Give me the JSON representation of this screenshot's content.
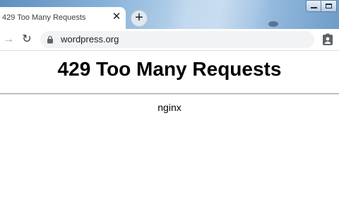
{
  "browser": {
    "tab": {
      "title": "429 Too Many Requests",
      "close_glyph": "✕"
    },
    "new_tab_glyph": "+",
    "toolbar": {
      "back_glyph": "→",
      "reload_glyph": "↻",
      "url": "wordpress.org",
      "lock_icon": "lock-icon",
      "profile_icon": "account-badge-icon"
    },
    "window_controls": [
      "minimize-icon",
      "maximize-icon"
    ],
    "colors": {
      "tab_strip": "#86b0d8",
      "omnibox": "#f1f3f4"
    }
  },
  "page": {
    "heading": "429 Too Many Requests",
    "server": "nginx"
  }
}
